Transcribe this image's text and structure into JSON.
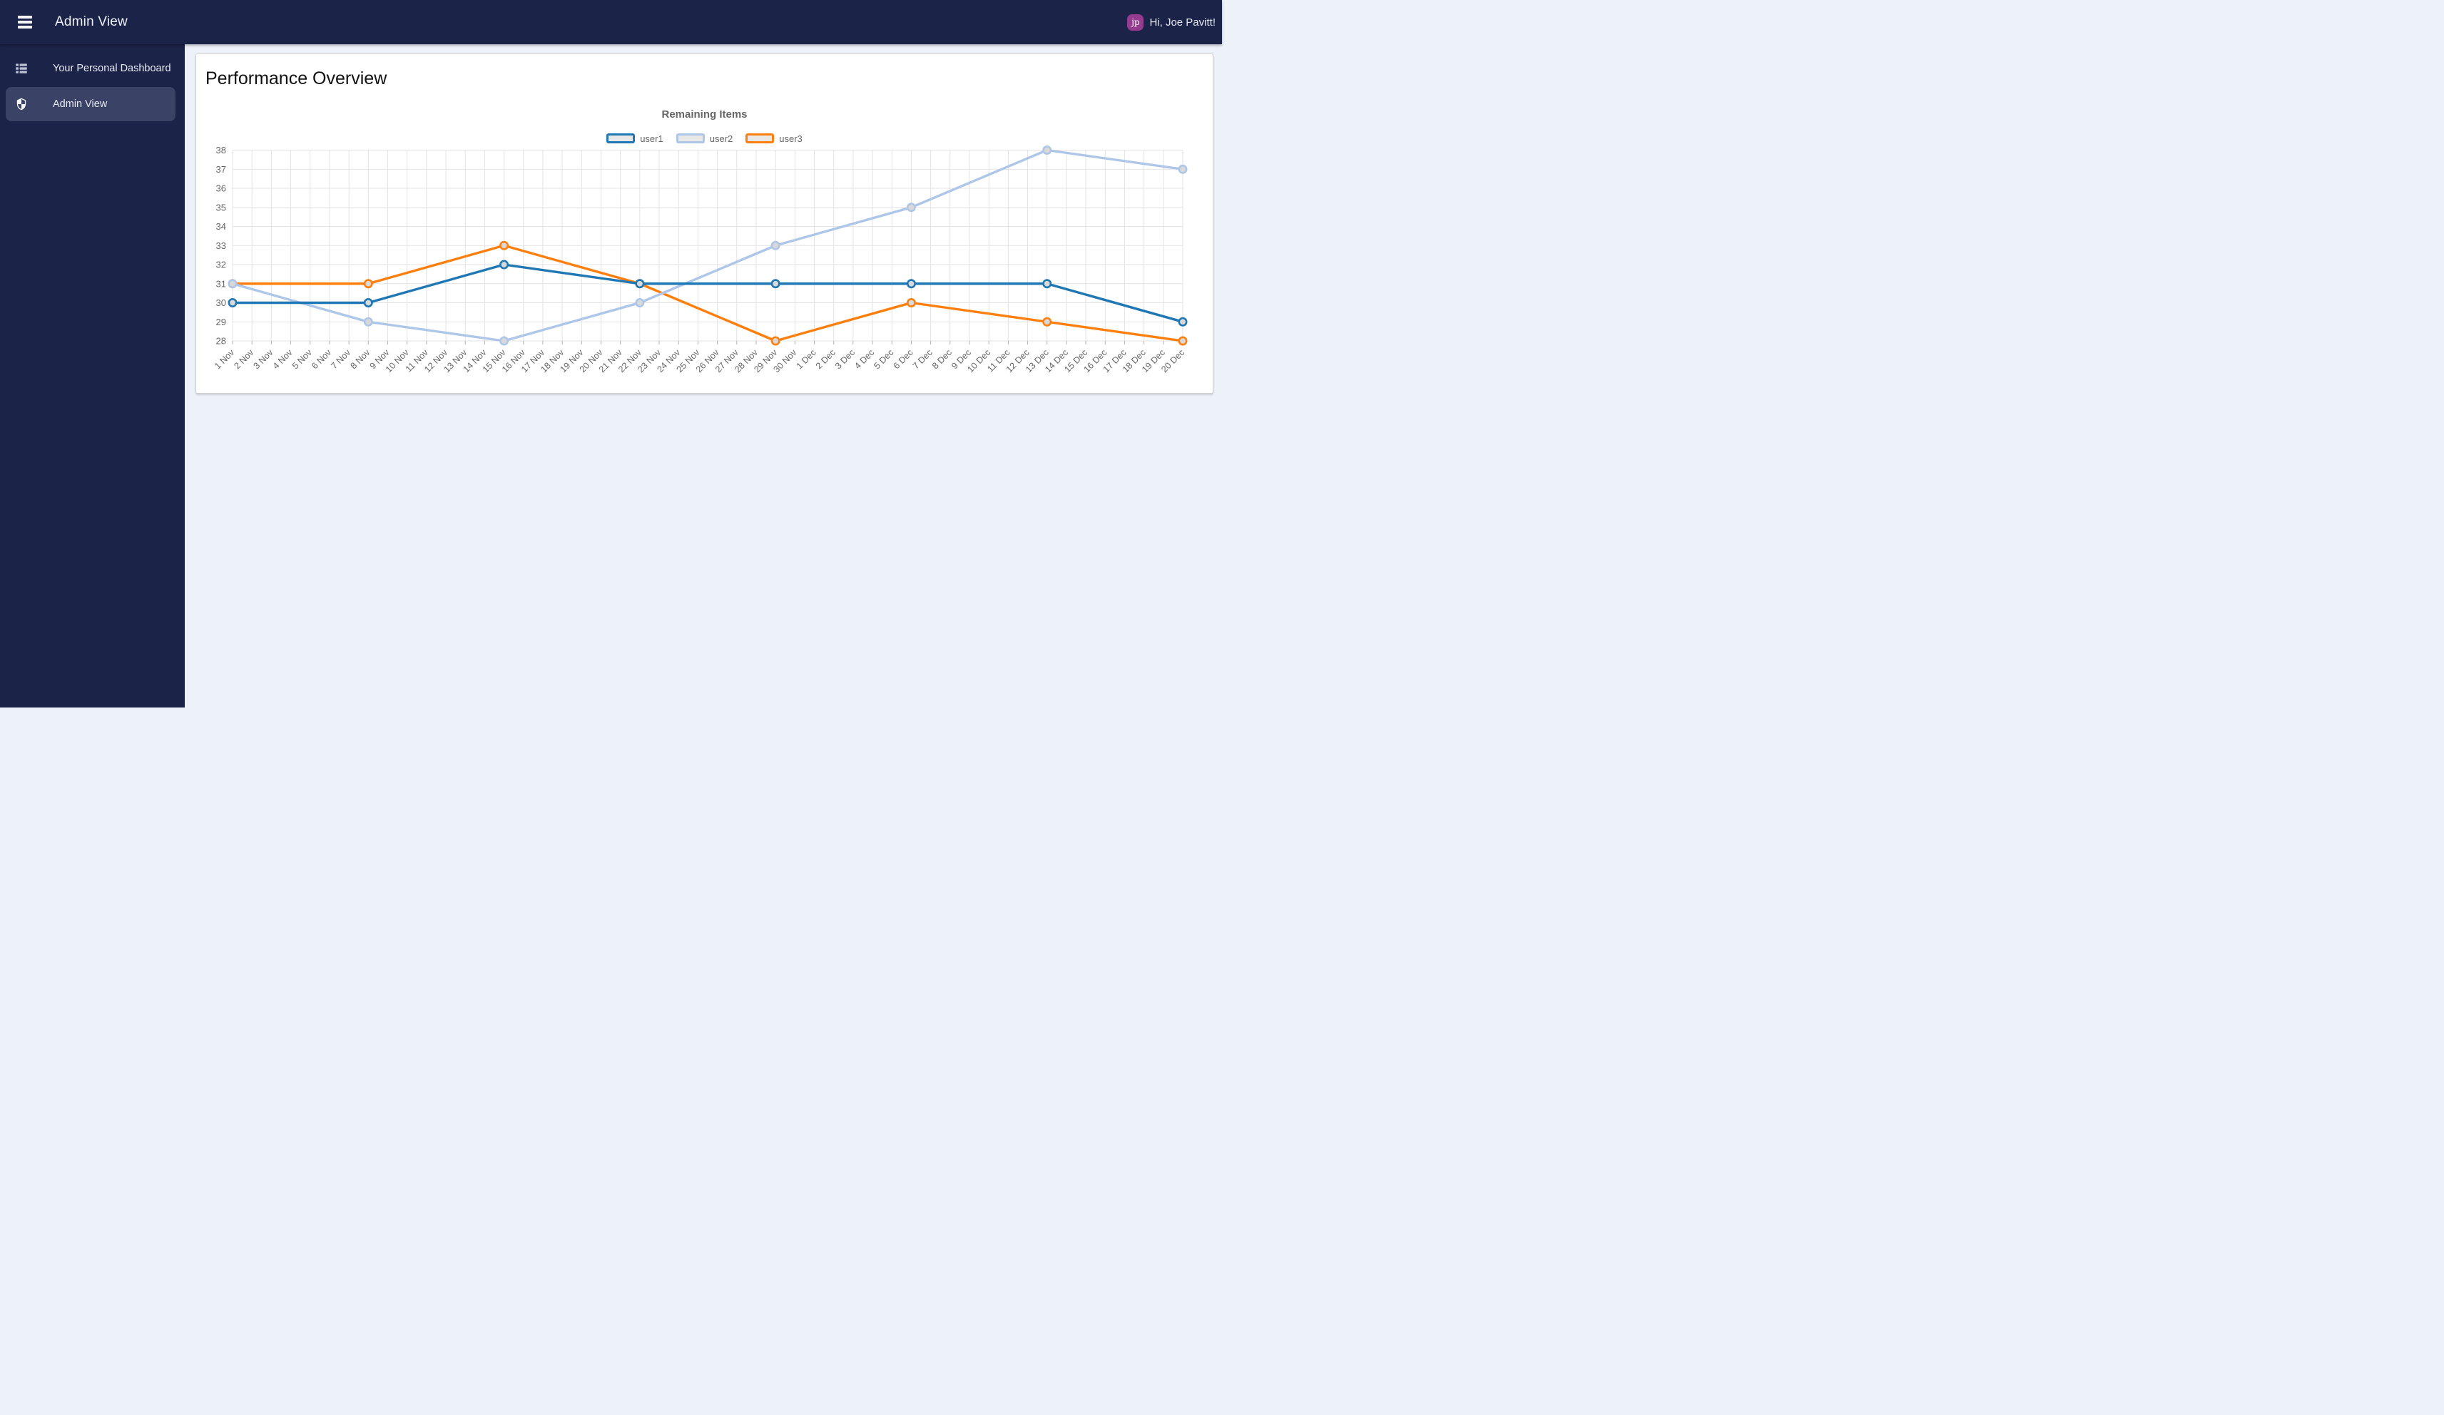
{
  "topbar": {
    "title": "Admin View",
    "greeting": "Hi, Joe Pavitt!",
    "avatar_initials": "jp",
    "avatar_color": "#953c90"
  },
  "sidebar": {
    "items": [
      {
        "label": "Your Personal Dashboard",
        "icon": "dashboard-grid-icon",
        "active": false
      },
      {
        "label": "Admin View",
        "icon": "shield-icon",
        "active": true
      }
    ]
  },
  "main": {
    "card_title": "Performance Overview"
  },
  "chart_data": {
    "type": "line",
    "title": "Remaining Items",
    "xlabel": "",
    "ylabel": "",
    "ylim": [
      28,
      38
    ],
    "y_tick_step": 1,
    "grid": true,
    "legend_position": "top",
    "x_labels": [
      "1 Nov",
      "2 Nov",
      "3 Nov",
      "4 Nov",
      "5 Nov",
      "6 Nov",
      "7 Nov",
      "8 Nov",
      "9 Nov",
      "10 Nov",
      "11 Nov",
      "12 Nov",
      "13 Nov",
      "14 Nov",
      "15 Nov",
      "16 Nov",
      "17 Nov",
      "18 Nov",
      "19 Nov",
      "20 Nov",
      "21 Nov",
      "22 Nov",
      "23 Nov",
      "24 Nov",
      "25 Nov",
      "26 Nov",
      "27 Nov",
      "28 Nov",
      "29 Nov",
      "30 Nov",
      "1 Dec",
      "2 Dec",
      "3 Dec",
      "4 Dec",
      "5 Dec",
      "6 Dec",
      "7 Dec",
      "8 Dec",
      "9 Dec",
      "10 Dec",
      "11 Dec",
      "12 Dec",
      "13 Dec",
      "14 Dec",
      "15 Dec",
      "16 Dec",
      "17 Dec",
      "18 Dec",
      "19 Dec",
      "20 Dec"
    ],
    "point_indices": [
      0,
      7,
      14,
      21,
      28,
      35,
      42,
      49
    ],
    "point_dates": [
      "1 Nov",
      "8 Nov",
      "15 Nov",
      "22 Nov",
      "29 Nov",
      "6 Dec",
      "13 Dec",
      "20 Dec"
    ],
    "series": [
      {
        "name": "user1",
        "color": "#1f77b4",
        "values": [
          30,
          30,
          32,
          31,
          31,
          31,
          31,
          29
        ]
      },
      {
        "name": "user2",
        "color": "#aec7e8",
        "values": [
          31,
          29,
          28,
          30,
          33,
          35,
          38,
          37
        ]
      },
      {
        "name": "user3",
        "color": "#ff7f0e",
        "values": [
          31,
          31,
          33,
          31,
          28,
          30,
          29,
          28
        ]
      }
    ],
    "marker_fill": "#d9d9d9",
    "grid_color": "#e3e3e3",
    "tick_color": "#b3b3b3"
  }
}
